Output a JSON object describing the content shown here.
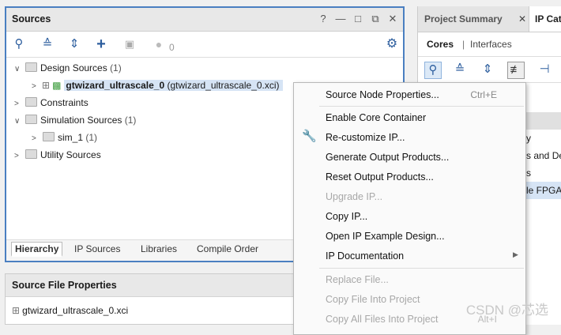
{
  "sources": {
    "title": "Sources",
    "header_buttons": [
      "?",
      "—",
      "□",
      "⧉",
      "✕"
    ],
    "toolbar_count": "0",
    "tree": {
      "design_sources": {
        "label": "Design Sources",
        "count": "(1)"
      },
      "gtwizard": {
        "label": "gtwizard_ultrascale_0",
        "detail": "(gtwizard_ultrascale_0.xci)"
      },
      "constraints": {
        "label": "Constraints"
      },
      "sim_sources": {
        "label": "Simulation Sources",
        "count": "(1)"
      },
      "sim_1": {
        "label": "sim_1",
        "count": "(1)"
      },
      "utility": {
        "label": "Utility Sources"
      }
    },
    "tabs": [
      "Hierarchy",
      "IP Sources",
      "Libraries",
      "Compile Order"
    ]
  },
  "source_file_properties": {
    "title": "Source File Properties",
    "file": "gtwizard_ultrascale_0.xci"
  },
  "right_panel": {
    "tabs": [
      "Project Summary",
      "IP Cat"
    ],
    "subtabs": [
      "Cores",
      "Interfaces"
    ],
    "rows": [
      "y",
      "s and De",
      "s",
      "le FPGA"
    ]
  },
  "context_menu": {
    "items": [
      {
        "label": "Source Node Properties...",
        "shortcut": "Ctrl+E",
        "enabled": true
      },
      {
        "label": "Enable Core Container",
        "enabled": true
      },
      {
        "label": "Re-customize IP...",
        "enabled": true
      },
      {
        "label": "Generate Output Products...",
        "enabled": true
      },
      {
        "label": "Reset Output Products...",
        "enabled": true
      },
      {
        "label": "Upgrade IP...",
        "enabled": false
      },
      {
        "label": "Copy IP...",
        "enabled": true
      },
      {
        "label": "Open IP Example Design...",
        "enabled": true
      },
      {
        "label": "IP Documentation",
        "enabled": true
      },
      {
        "label": "Replace File...",
        "enabled": false
      },
      {
        "label": "Copy File Into Project",
        "enabled": false
      },
      {
        "label": "Copy All Files Into Project",
        "shortcut": "Alt+I",
        "enabled": false
      }
    ]
  },
  "watermark": "CSDN @芯选"
}
